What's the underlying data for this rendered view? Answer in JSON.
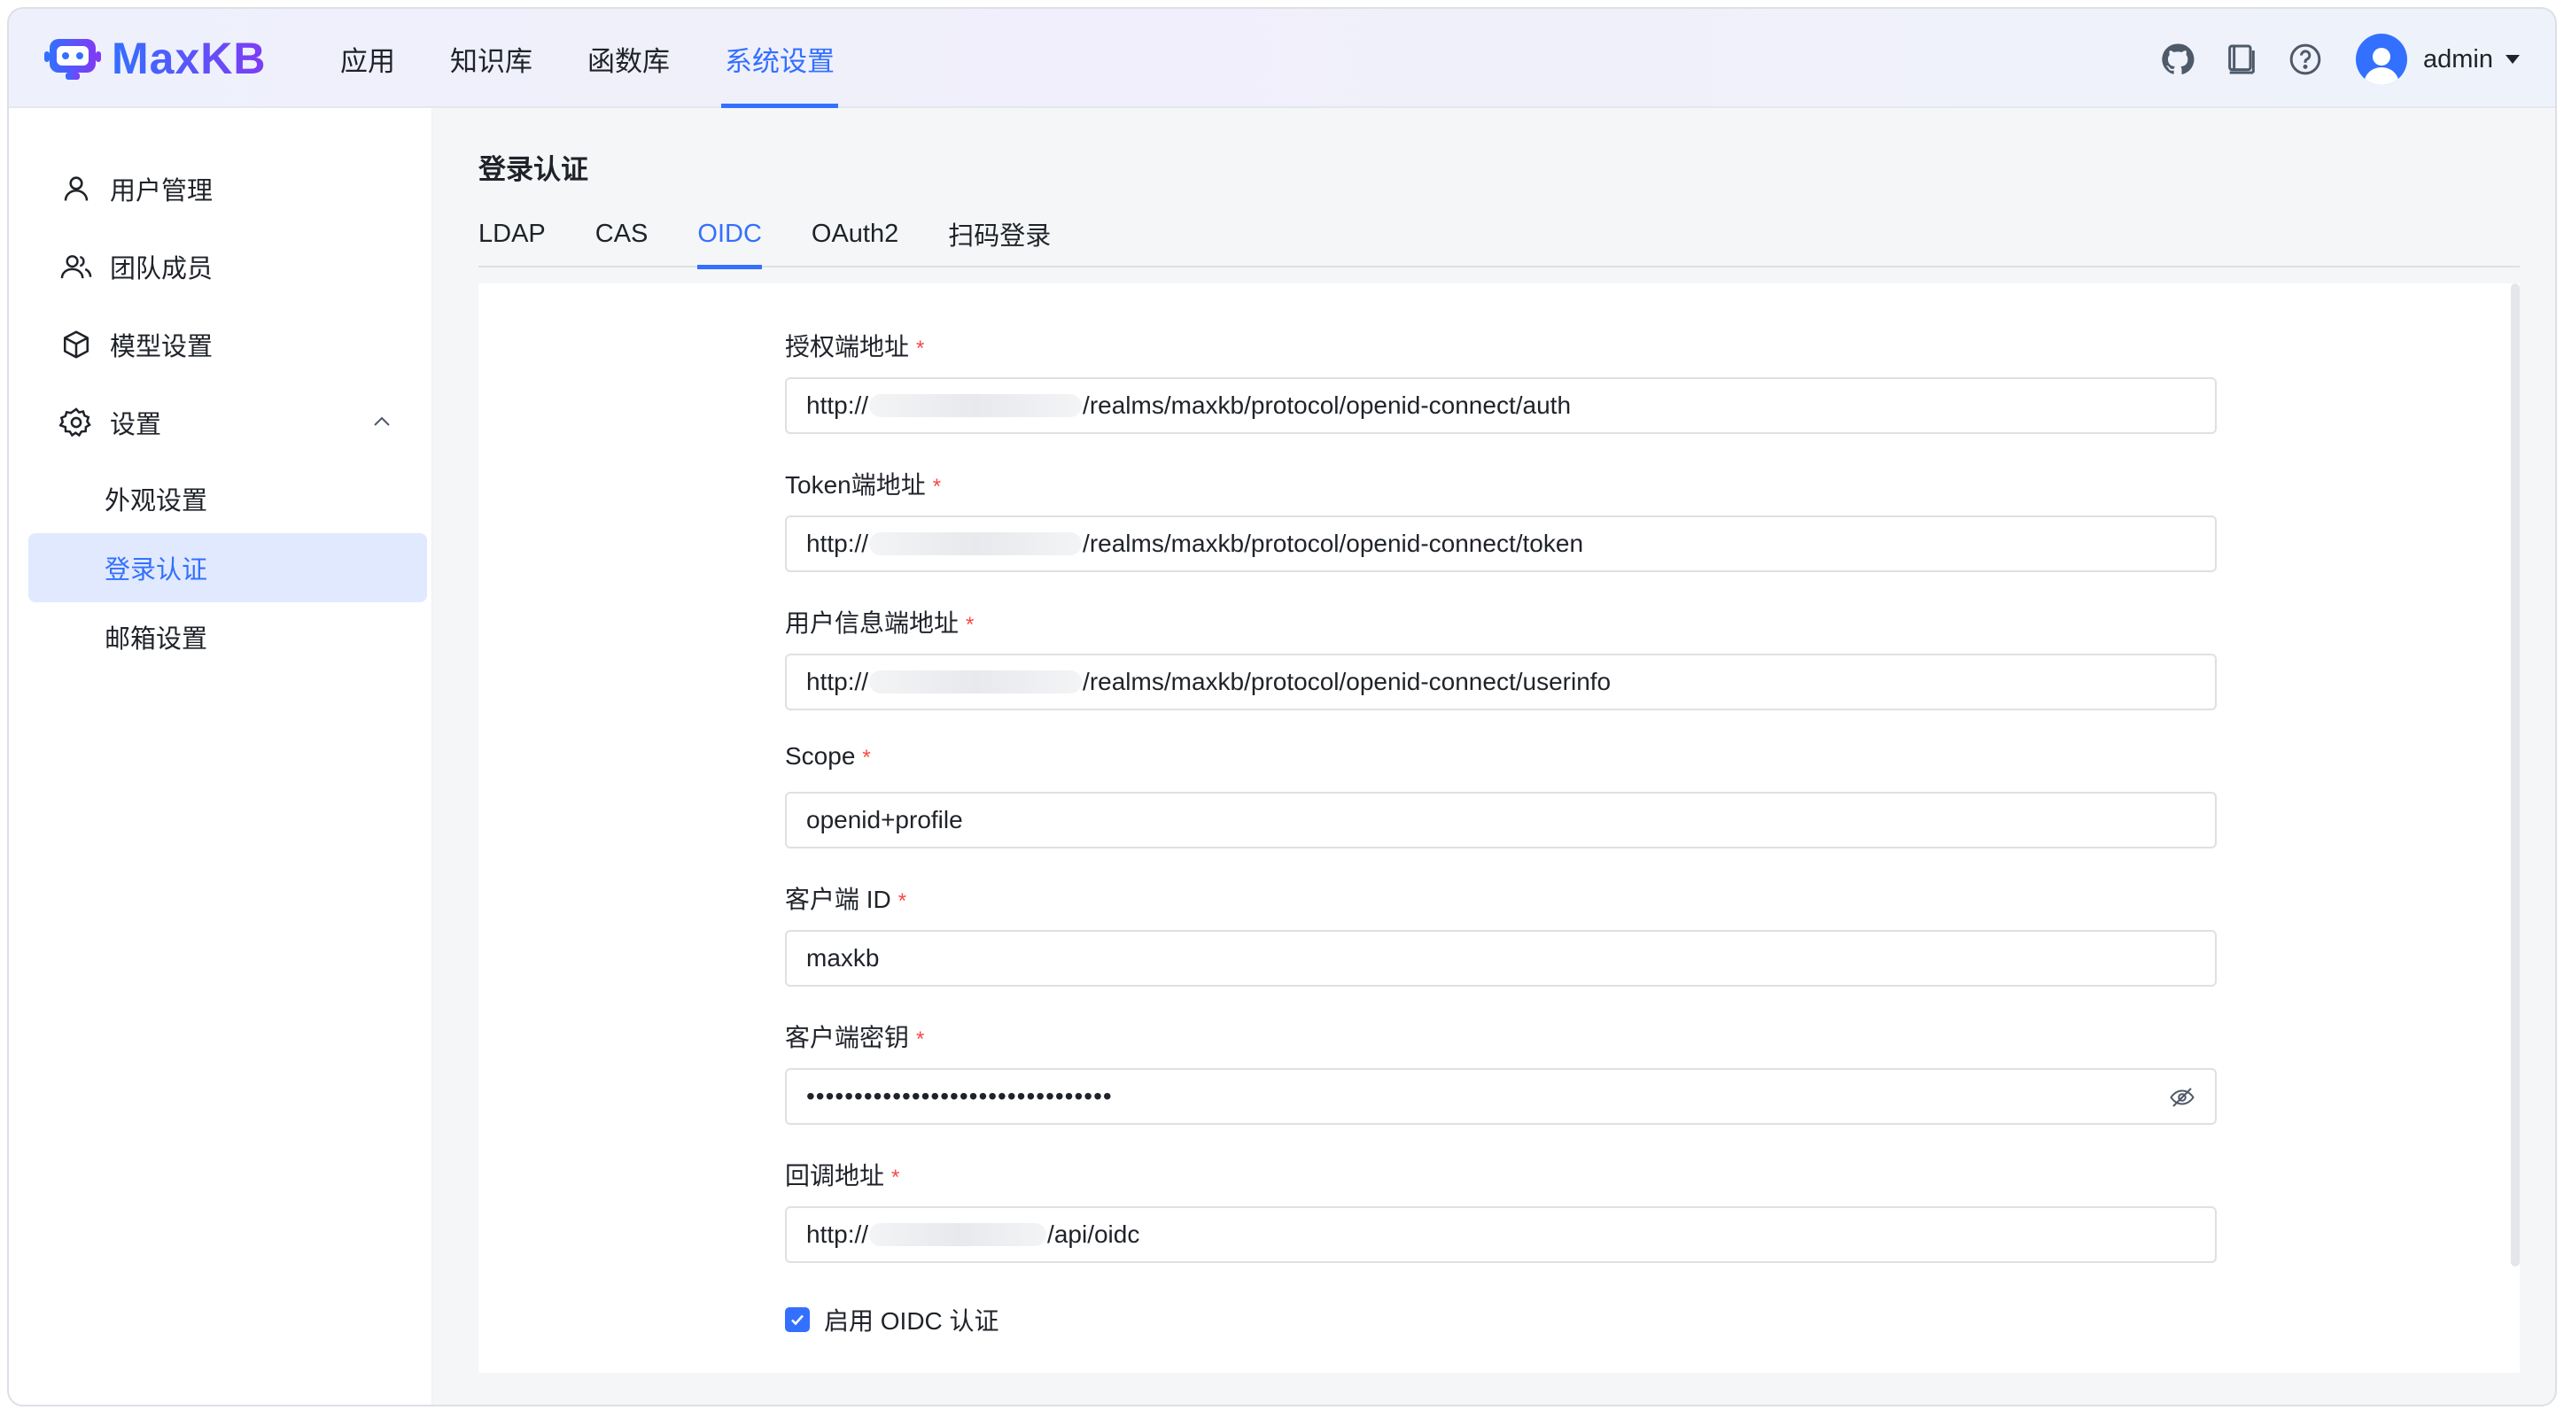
{
  "app": {
    "logo_text": "MaxKB"
  },
  "topnav": {
    "items": [
      {
        "label": "应用"
      },
      {
        "label": "知识库"
      },
      {
        "label": "函数库"
      },
      {
        "label": "系统设置"
      }
    ],
    "active_index": 3
  },
  "header": {
    "icons": [
      "github-icon",
      "book-icon",
      "help-icon"
    ],
    "user_name": "admin"
  },
  "sidebar": {
    "items": [
      {
        "label": "用户管理",
        "icon": "user-icon"
      },
      {
        "label": "团队成员",
        "icon": "team-icon"
      },
      {
        "label": "模型设置",
        "icon": "cube-icon"
      },
      {
        "label": "设置",
        "icon": "gear-icon",
        "expanded": true
      }
    ],
    "sub_items": [
      {
        "label": "外观设置"
      },
      {
        "label": "登录认证",
        "active": true
      },
      {
        "label": "邮箱设置"
      }
    ]
  },
  "main": {
    "title": "登录认证",
    "tabs": [
      {
        "label": "LDAP"
      },
      {
        "label": "CAS"
      },
      {
        "label": "OIDC"
      },
      {
        "label": "OAuth2"
      },
      {
        "label": "扫码登录"
      }
    ],
    "active_tab": 2
  },
  "form": {
    "auth_url": {
      "label": "授权端地址",
      "prefix": "http://",
      "suffix": "/realms/maxkb/protocol/openid-connect/auth"
    },
    "token_url": {
      "label": "Token端地址",
      "prefix": "http://",
      "suffix": "/realms/maxkb/protocol/openid-connect/token"
    },
    "userinfo_url": {
      "label": "用户信息端地址",
      "prefix": "http://",
      "suffix": "/realms/maxkb/protocol/openid-connect/userinfo"
    },
    "scope": {
      "label": "Scope",
      "value": "openid+profile"
    },
    "client_id": {
      "label": "客户端 ID",
      "value": "maxkb"
    },
    "client_secret": {
      "label": "客户端密钥",
      "value": "••••••••••••••••••••••••••••••••"
    },
    "callback_url": {
      "label": "回调地址",
      "prefix": "http://",
      "suffix": "/api/oidc"
    },
    "enable": {
      "label": "启用 OIDC 认证",
      "checked": true
    },
    "required_mark": "*"
  },
  "colors": {
    "accent": "#3370ff",
    "required": "#f54a45",
    "active_bg": "#e1e9fe"
  }
}
